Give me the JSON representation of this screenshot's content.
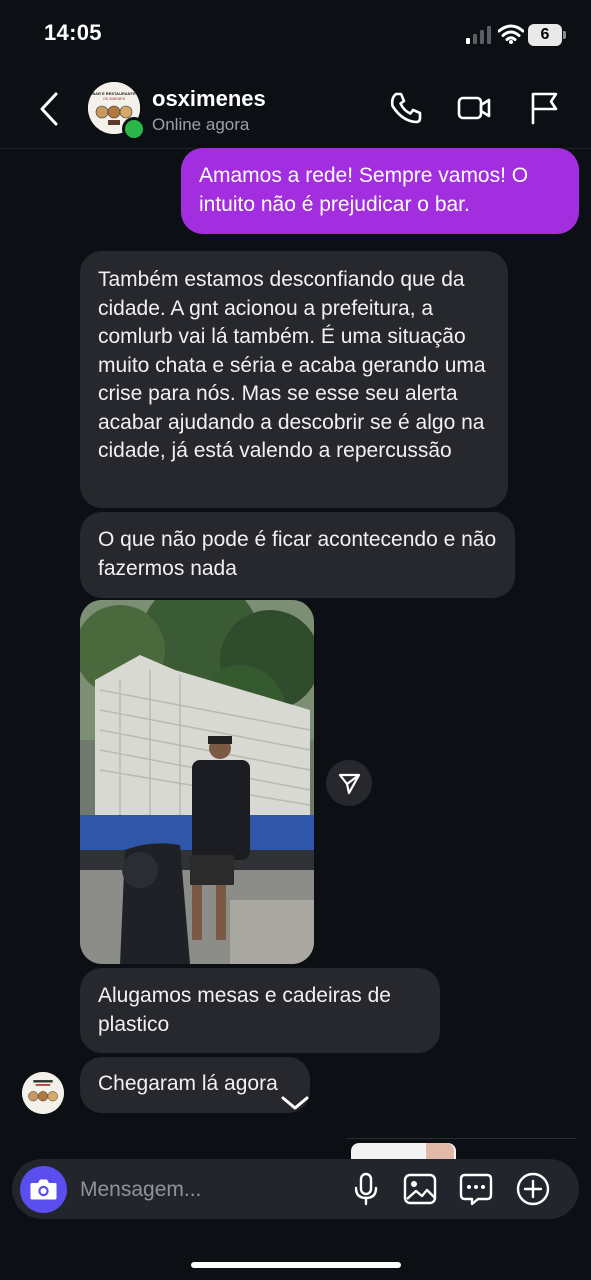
{
  "status_bar": {
    "time": "14:05",
    "battery": "6"
  },
  "header": {
    "contact_name": "osximenes",
    "status": "Online agora"
  },
  "logo": {
    "line1": "BAR E RESTAURANTE",
    "line2": "OS XIMENES"
  },
  "messages": {
    "sent_1": "Amamos a rede! Sempre vamos! O intuito não é prejudicar o bar.",
    "recv_1": "Também estamos desconfiando que da cidade. A gnt acionou a prefeitura, a comlurb vai lá também. É uma situação muito chata e séria e acaba gerando uma crise para nós. Mas se esse seu alerta acabar ajudando a descobrir se é algo na cidade, já está valendo a repercussão",
    "recv_2": "O que não pode é ficar acontecendo e não fazermos nada",
    "recv_3": "Alugamos mesas e cadeiras de plastico",
    "recv_4": "Chegaram lá agora"
  },
  "composer": {
    "placeholder": "Mensagem..."
  },
  "colors": {
    "sent_bubble": "#a22ee0",
    "recv_bubble": "#26282d",
    "background": "#0c0f14",
    "camera": "#5a4fee",
    "online": "#2bb74a"
  }
}
